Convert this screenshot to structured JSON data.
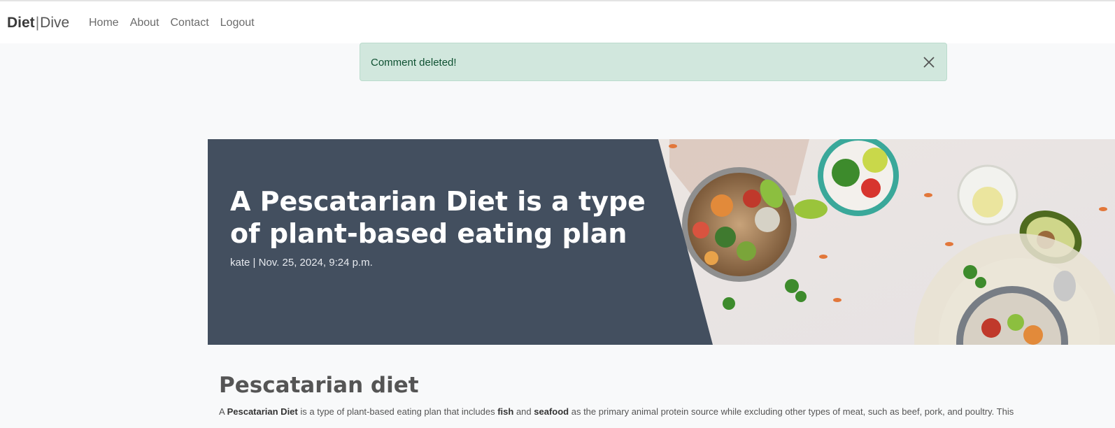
{
  "navbar": {
    "brand_part1": "Diet",
    "brand_separator": "|",
    "brand_part2": "Dive",
    "links": [
      "Home",
      "About",
      "Contact",
      "Logout"
    ]
  },
  "alert": {
    "message": "Comment deleted!",
    "close_icon": "close-icon",
    "color": "#d1e7dd"
  },
  "hero": {
    "title": "A Pescatarian Diet is a type of plant-based eating plan",
    "author": "kate",
    "meta_separator": "|",
    "date": "Nov. 25, 2024, 9:24 p.m.",
    "panel_color": "#434f5f"
  },
  "article": {
    "heading": "Pescatarian diet",
    "p1_a": "A ",
    "p1_b": "Pescatarian Diet",
    "p1_c": " is a type of plant-based eating plan that includes ",
    "p1_d": "fish",
    "p1_e": " and ",
    "p1_f": "seafood",
    "p1_g": " as the primary animal protein source while excluding other types of meat, such as beef, pork, and poultry. This"
  }
}
